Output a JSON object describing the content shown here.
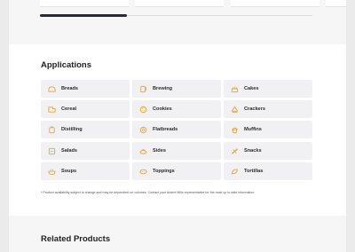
{
  "applications": {
    "title": "Applications",
    "items": [
      {
        "label": "Breads",
        "icon": "bread-icon"
      },
      {
        "label": "Brewing",
        "icon": "brewing-icon"
      },
      {
        "label": "Cakes",
        "icon": "cake-icon"
      },
      {
        "label": "Cereal",
        "icon": "cereal-icon"
      },
      {
        "label": "Cookies",
        "icon": "cookie-icon"
      },
      {
        "label": "Crackers",
        "icon": "cracker-icon"
      },
      {
        "label": "Distilling",
        "icon": "distilling-icon"
      },
      {
        "label": "Flatbreads",
        "icon": "flatbread-icon"
      },
      {
        "label": "Muffins",
        "icon": "muffin-icon"
      },
      {
        "label": "Salads",
        "icon": "salad-icon"
      },
      {
        "label": "Sides",
        "icon": "sides-icon"
      },
      {
        "label": "Snacks",
        "icon": "snack-icon"
      },
      {
        "label": "Soups",
        "icon": "soup-icon"
      },
      {
        "label": "Toppings",
        "icon": "topping-icon"
      },
      {
        "label": "Tortillas",
        "icon": "tortilla-icon"
      }
    ]
  },
  "note": "* Product availability subject to change and may be dependent on volumes. Contact your Ardent Mills representative for the most up to date information.",
  "related": {
    "title": "Related Products"
  },
  "colors": {
    "accent": "#e8a33d",
    "tile_bg": "#f1f1f3",
    "slider": "#2a2a32"
  }
}
